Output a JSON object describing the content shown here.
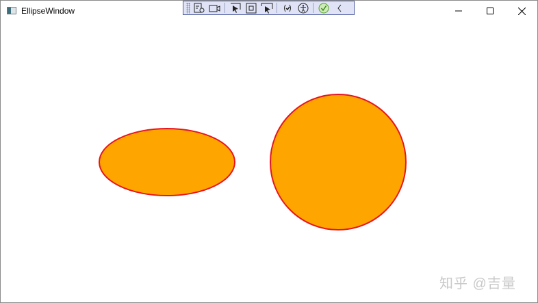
{
  "window": {
    "title": "EllipseWindow"
  },
  "toolbar": {
    "icons": [
      "select-element-icon",
      "video-icon",
      "pointer-select-icon",
      "square-frame-icon",
      "display-layout-icon",
      "binding-check-icon",
      "accessibility-icon",
      "check-circle-icon",
      "collapse-chevron-icon"
    ]
  },
  "shapes": {
    "fill": "#FFA500",
    "stroke": "#E8141E"
  },
  "watermark": {
    "text": "知乎 @吉量"
  }
}
